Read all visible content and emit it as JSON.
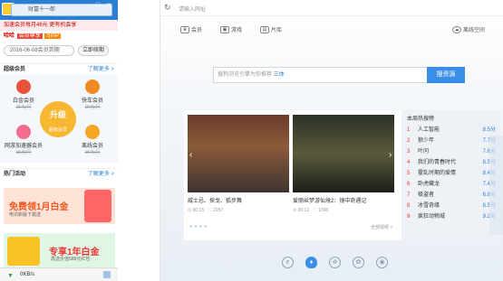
{
  "left_panel": {
    "username": "财富十一郎",
    "window_controls": [
      "—",
      "□",
      "✕"
    ],
    "promo_text": "加速会员每月46元 更有机会享",
    "vip_line": {
      "prefix": "哈哈",
      "badge1": "会员尊享",
      "badge2": "SVIP"
    },
    "expiry": "2016-06-08会员到期",
    "renew_button": "立即续期",
    "vip_section": {
      "title": "超级会员",
      "more": "了解更多 >",
      "items": [
        {
          "name": "白金会员",
          "price": "15元/月",
          "icon": "rocket-icon",
          "color": "#e8523a"
        },
        {
          "name": "快车会员",
          "price": "15元/月",
          "icon": "speed-icon",
          "color": "#f08a24"
        },
        {
          "name": "网游加速器会员",
          "price": "15元/月",
          "icon": "game-icon",
          "color": "#f36c8d"
        },
        {
          "name": "离线会员",
          "price": "15元/月",
          "icon": "cloud-icon",
          "color": "#f6a623"
        }
      ],
      "upgrade_label": "升级",
      "upgrade_sub": "超级会员"
    },
    "activity_section": {
      "title": "热门活动",
      "more": "了解更多 >"
    },
    "banner1": {
      "title": "免费领1月白金",
      "subtitle": "电讯新版下载送"
    },
    "banner2": {
      "title": "专享1年白金",
      "subtitle": "再送价值588元红包"
    },
    "status": {
      "speed": "0KB/s",
      "download_icon": "download-arrow-icon"
    }
  },
  "browser": {
    "address_placeholder": "请输入网址",
    "nav": [
      {
        "label": "会员",
        "icon": "crown-icon"
      },
      {
        "label": "游戏",
        "icon": "game-icon"
      },
      {
        "label": "片库",
        "icon": "film-icon"
      }
    ],
    "nav_right": "离线空间",
    "search": {
      "placeholder": "搜狗浏览引擎为你推荐",
      "highlight": "三体",
      "button": "搜资源"
    },
    "cards": [
      {
        "title": "威士忌、探戈、狐步舞",
        "duration": "00:15",
        "likes": "2287"
      },
      {
        "title": "爱丽丝梦游仙境2：镜中奇遇记",
        "duration": "00:12",
        "likes": "1090"
      }
    ],
    "all_videos": "全部视频 >",
    "rank": {
      "title": "本周热搜榜",
      "items": [
        {
          "n": "1",
          "name": "人工智能",
          "score": "8.5分"
        },
        {
          "n": "2",
          "name": "狼少年",
          "score": "7.7分"
        },
        {
          "n": "3",
          "name": "叶问",
          "score": "7.6分"
        },
        {
          "n": "4",
          "name": "我们的青春时代",
          "score": "8.5分"
        },
        {
          "n": "5",
          "name": "霍乱时期的爱情",
          "score": "8.4分"
        },
        {
          "n": "6",
          "name": "卧虎藏龙",
          "score": "7.4分"
        },
        {
          "n": "7",
          "name": "极盗者",
          "score": "6.8分"
        },
        {
          "n": "8",
          "name": "冰雪奇缘",
          "score": "8.5分"
        },
        {
          "n": "9",
          "name": "疯狂动物城",
          "score": "9.2分"
        }
      ]
    },
    "dock": [
      "e-icon",
      "drop-icon",
      "gamepad-icon",
      "ball-icon",
      "eye-icon"
    ]
  }
}
